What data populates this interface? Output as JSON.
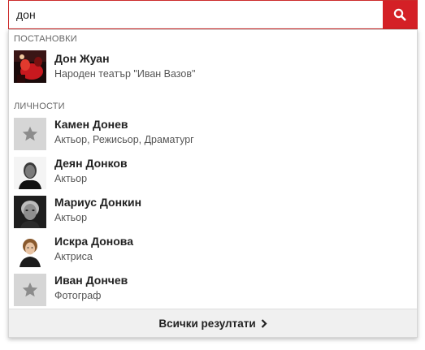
{
  "search": {
    "value": "дон",
    "icon": "search-icon",
    "button_color": "#d42026"
  },
  "sections": {
    "productions": {
      "header": "ПОСТАНОВКИ",
      "items": [
        {
          "title": "Дон Жуан",
          "subtitle": "Народен театър \"Иван Вазов\"",
          "thumb": "production-photo"
        }
      ]
    },
    "people": {
      "header": "ЛИЧНОСТИ",
      "items": [
        {
          "title": "Камен Донев",
          "subtitle": "Актьор, Режисьор, Драматург",
          "thumb": "star-placeholder-icon"
        },
        {
          "title": "Деян Донков",
          "subtitle": "Актьор",
          "thumb": "portrait-photo"
        },
        {
          "title": "Мариус Донкин",
          "subtitle": "Актьор",
          "thumb": "portrait-photo"
        },
        {
          "title": "Искра Донова",
          "subtitle": "Актриса",
          "thumb": "portrait-photo"
        },
        {
          "title": "Иван Дончев",
          "subtitle": "Фотограф",
          "thumb": "star-placeholder-icon"
        }
      ]
    }
  },
  "footer": {
    "label": "Всички резултати",
    "icon": "chevron-right-icon"
  }
}
